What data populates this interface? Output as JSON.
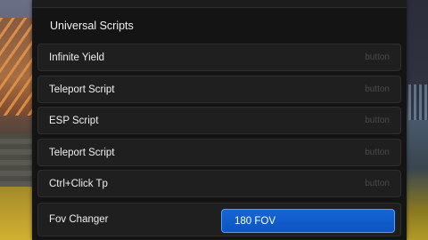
{
  "section": {
    "title": "Universal Scripts"
  },
  "scripts": [
    {
      "label": "Infinite Yield",
      "action": "button"
    },
    {
      "label": "Teleport Script",
      "action": "button"
    },
    {
      "label": "ESP Script",
      "action": "button"
    },
    {
      "label": "Teleport Script",
      "action": "button"
    },
    {
      "label": "Ctrl+Click Tp",
      "action": "button"
    }
  ],
  "fov": {
    "label": "Fov Changer",
    "value": "180 FOV"
  },
  "colors": {
    "panel_bg": "#141414",
    "row_bg": "#1f1f1f",
    "accent": "#1565d8"
  }
}
